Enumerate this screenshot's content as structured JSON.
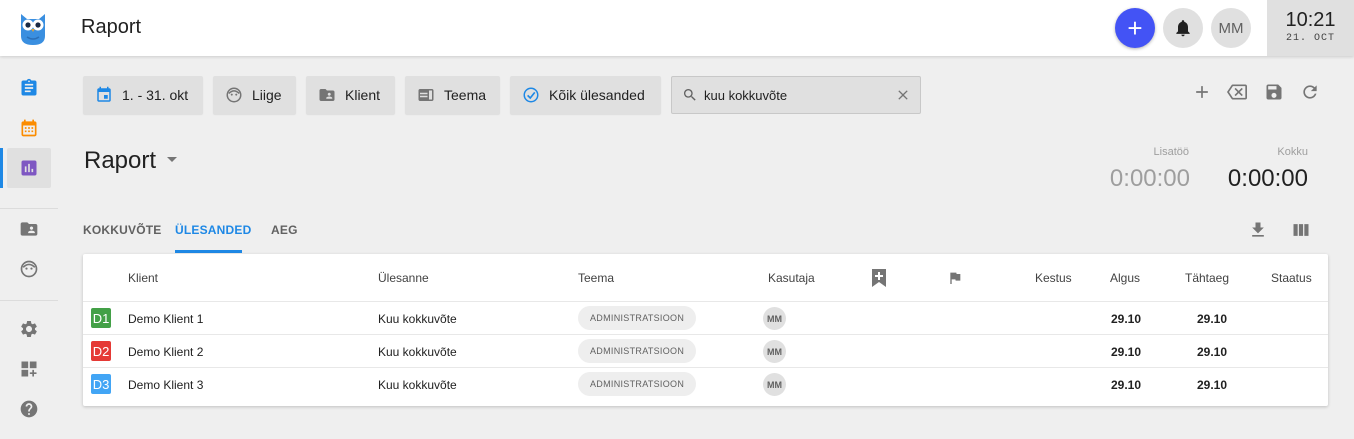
{
  "topbar": {
    "title": "Raport",
    "add_icon": "plus-icon",
    "bell_icon": "bell-icon",
    "avatar_initials": "MM",
    "clock_time": "10:21",
    "clock_date": "21. OCT"
  },
  "sidebar": {
    "items": [
      {
        "icon": "clipboard-icon",
        "color": "#1e88e5"
      },
      {
        "icon": "calendar-icon",
        "color": "#fb8c00"
      },
      {
        "icon": "report-chart-icon",
        "color": "#7e57c2",
        "active": true
      },
      {
        "icon": "client-folder-icon",
        "color": "#757575"
      },
      {
        "icon": "member-face-icon",
        "color": "#757575"
      },
      {
        "icon": "settings-gear-icon",
        "color": "#757575"
      },
      {
        "icon": "add-widget-icon",
        "color": "#757575"
      },
      {
        "icon": "help-icon",
        "color": "#757575"
      }
    ]
  },
  "filters": {
    "date_range": "1. - 31. okt",
    "member": "Liige",
    "client": "Klient",
    "theme": "Teema",
    "tasks": "Kõik ülesanded"
  },
  "search": {
    "value": "kuu kokkuvõte"
  },
  "page": {
    "title": "Raport"
  },
  "stats": {
    "extra_label": "Lisatöö",
    "extra_value": "0:00:00",
    "total_label": "Kokku",
    "total_value": "0:00:00"
  },
  "tabs": [
    "KOKKUVÕTE",
    "ÜLESANDED",
    "AEG"
  ],
  "table": {
    "headers": {
      "client": "Klient",
      "task": "Ülesanne",
      "theme": "Teema",
      "user": "Kasutaja",
      "duration": "Kestus",
      "start": "Algus",
      "deadline": "Tähtaeg",
      "status": "Staatus"
    },
    "rows": [
      {
        "badge": "D1",
        "badge_color": "#43a047",
        "client": "Demo Klient 1",
        "task": "Kuu kokkuvõte",
        "theme": "ADMINISTRATSIOON",
        "user": "MM",
        "start": "29.10",
        "deadline": "29.10"
      },
      {
        "badge": "D2",
        "badge_color": "#e53935",
        "client": "Demo Klient 2",
        "task": "Kuu kokkuvõte",
        "theme": "ADMINISTRATSIOON",
        "user": "MM",
        "start": "29.10",
        "deadline": "29.10"
      },
      {
        "badge": "D3",
        "badge_color": "#42a5f5",
        "client": "Demo Klient 3",
        "task": "Kuu kokkuvõte",
        "theme": "ADMINISTRATSIOON",
        "user": "MM",
        "start": "29.10",
        "deadline": "29.10"
      }
    ]
  },
  "colors": {
    "accent": "#1e88e5",
    "add_button": "#4353f5"
  }
}
